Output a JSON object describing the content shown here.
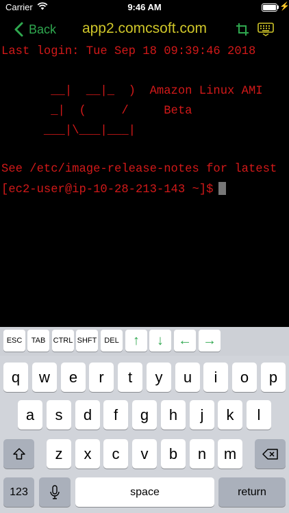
{
  "status_bar": {
    "carrier": "Carrier",
    "time": "9:46 AM"
  },
  "nav": {
    "back_label": "Back",
    "title": "app2.comcsoft.com"
  },
  "terminal": {
    "lines": [
      "Last login: Tue Sep 18 09:39:46 2018",
      "",
      "",
      "       __|  __|_  )  Amazon Linux AMI",
      "       _|  (     /     Beta",
      "      ___|\\___|___|",
      "",
      "See /etc/image-release-notes for latest",
      "[ec2-user@ip-10-28-213-143 ~]$"
    ]
  },
  "accessory_keys": [
    "ESC",
    "TAB",
    "CTRL",
    "SHFT",
    "DEL",
    "↑",
    "↓",
    "←",
    "→"
  ],
  "keyboard": {
    "row1": [
      "q",
      "w",
      "e",
      "r",
      "t",
      "y",
      "u",
      "i",
      "o",
      "p"
    ],
    "row2": [
      "a",
      "s",
      "d",
      "f",
      "g",
      "h",
      "j",
      "k",
      "l"
    ],
    "row3": [
      "z",
      "x",
      "c",
      "v",
      "b",
      "n",
      "m"
    ],
    "numbers_label": "123",
    "space_label": "space",
    "return_label": "return"
  },
  "colors": {
    "accent_green": "#2fa84f",
    "title_yellow": "#cfc629",
    "terminal_red": "#d21919"
  },
  "icons": [
    "wifi-icon",
    "battery-icon",
    "chevron-left-icon",
    "crop-icon",
    "keyboard-icon",
    "shift-icon",
    "microphone-icon",
    "backspace-icon"
  ]
}
